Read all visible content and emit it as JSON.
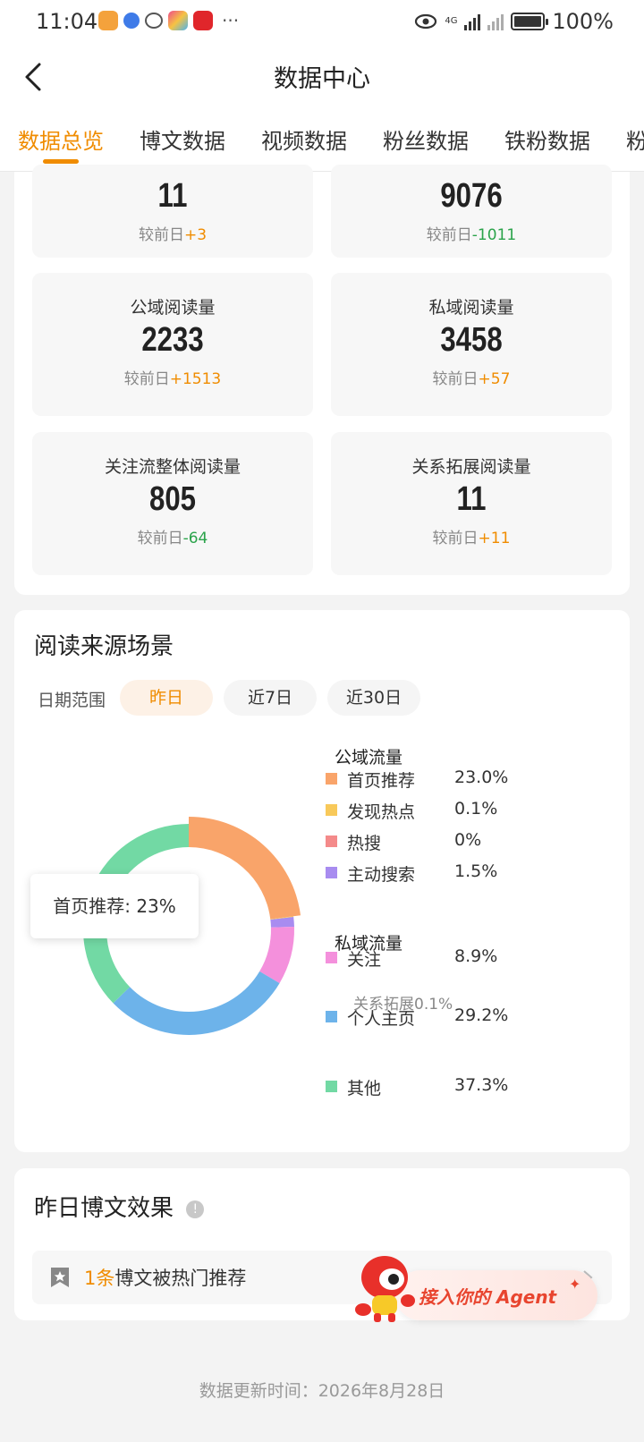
{
  "status_bar": {
    "time": "11:04",
    "battery": "100%",
    "net": "4G"
  },
  "nav": {
    "title": "数据中心"
  },
  "tabs": [
    "数据总览",
    "博文数据",
    "视频数据",
    "粉丝数据",
    "铁粉数据",
    "粉"
  ],
  "stats": [
    {
      "label": "",
      "value": "11",
      "delta_prefix": "较前日",
      "delta": "+3",
      "trend": "up"
    },
    {
      "label": "",
      "value": "9076",
      "delta_prefix": "较前日",
      "delta": "-1011",
      "trend": "down"
    },
    {
      "label": "公域阅读量",
      "value": "2233",
      "delta_prefix": "较前日",
      "delta": "+1513",
      "trend": "up"
    },
    {
      "label": "私域阅读量",
      "value": "3458",
      "delta_prefix": "较前日",
      "delta": "+57",
      "trend": "up"
    },
    {
      "label": "关注流整体阅读量",
      "value": "805",
      "delta_prefix": "较前日",
      "delta": "-64",
      "trend": "down"
    },
    {
      "label": "关系拓展阅读量",
      "value": "11",
      "delta_prefix": "较前日",
      "delta": "+11",
      "trend": "up"
    }
  ],
  "read_source": {
    "title": "阅读来源场景",
    "date_label": "日期范围",
    "date_options": [
      "昨日",
      "近7日",
      "近30日"
    ],
    "selected": "昨日",
    "tooltip": "首页推荐: 23%",
    "public_title": "公域流量",
    "private_title": "私域流量",
    "follow_note": "关系拓展0.1%"
  },
  "chart_data": {
    "type": "pie",
    "donut": true,
    "series": [
      {
        "name": "首页推荐",
        "value": 23.0,
        "label": "23.0%",
        "color": "#f9a46a",
        "group": "公域流量"
      },
      {
        "name": "发现热点",
        "value": 0.1,
        "label": "0.1%",
        "color": "#f8c95a",
        "group": "公域流量"
      },
      {
        "name": "热搜",
        "value": 0,
        "label": "0%",
        "color": "#f48a8a",
        "group": "公域流量"
      },
      {
        "name": "主动搜索",
        "value": 1.5,
        "label": "1.5%",
        "color": "#a88cf0",
        "group": "公域流量"
      },
      {
        "name": "关注",
        "value": 8.9,
        "label": "8.9%",
        "color": "#f490dc",
        "group": "私域流量"
      },
      {
        "name": "个人主页",
        "value": 29.2,
        "label": "29.2%",
        "color": "#6db3ea",
        "group": "私域流量"
      },
      {
        "name": "其他",
        "value": 37.3,
        "label": "37.3%",
        "color": "#72d9a4",
        "group": ""
      }
    ],
    "highlighted": "首页推荐"
  },
  "effect": {
    "title": "昨日博文效果",
    "rec_count": "1条",
    "rec_text": "博文被热门推荐",
    "agent_label": "接入你的 Agent"
  },
  "footer": {
    "update_text": "数据更新时间：2026年8月28日"
  }
}
